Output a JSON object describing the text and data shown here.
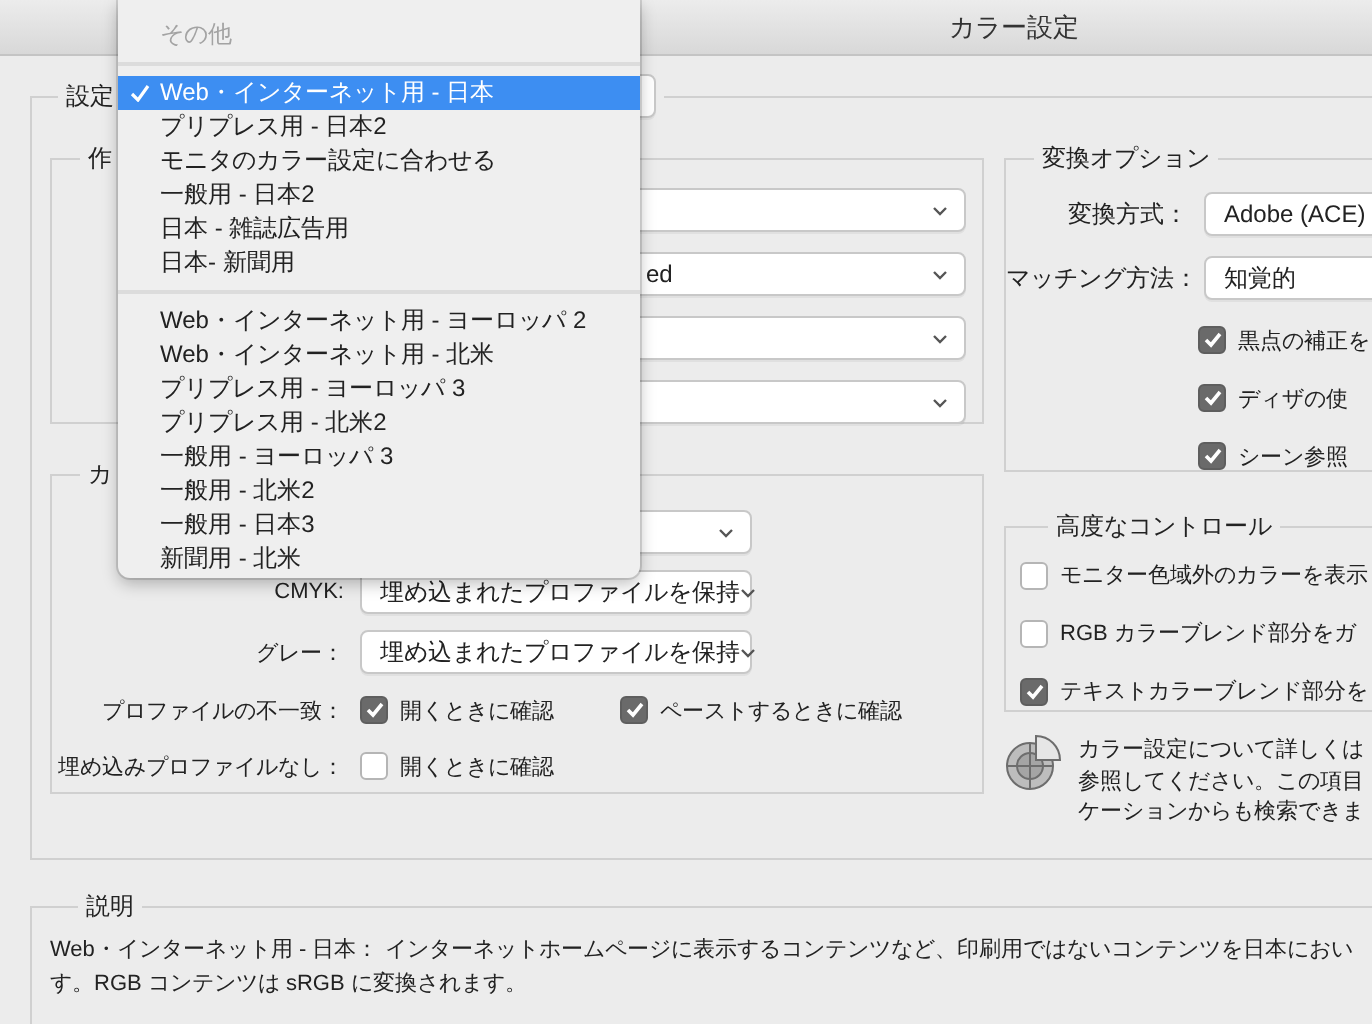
{
  "window": {
    "title": "カラー設定"
  },
  "settings": {
    "label": "設定"
  },
  "working_spaces": {
    "legend": "作",
    "selects": [
      {
        "kind": "dropdown"
      },
      {
        "kind": "dropdown",
        "value": "ed"
      },
      {
        "kind": "dropdown"
      },
      {
        "kind": "dropdown"
      }
    ]
  },
  "color_management": {
    "legend": "カ",
    "rgb": {
      "kind": "dropdown"
    },
    "cmyk": {
      "label": "CMYK:",
      "value": "埋め込まれたプロファイルを保持"
    },
    "gray": {
      "label": "グレー：",
      "value": "埋め込まれたプロファイルを保持"
    },
    "profile_mismatch": {
      "label": "プロファイルの不一致：",
      "checkboxes": [
        {
          "label": "開くときに確認",
          "checked": true
        },
        {
          "label": "ペーストするときに確認",
          "checked": true
        }
      ]
    },
    "missing_profile": {
      "label": "埋め込みプロファイルなし：",
      "checkboxes": [
        {
          "label": "開くときに確認",
          "checked": false
        }
      ]
    }
  },
  "conversion_options": {
    "legend": "変換オプション",
    "engine": {
      "label": "変換方式：",
      "value": "Adobe (ACE)"
    },
    "intent": {
      "label": "マッチング方法：",
      "value": "知覚的"
    },
    "checkboxes": [
      {
        "label": "黒点の補正を",
        "checked": true
      },
      {
        "label": "ディザの使",
        "checked": true
      },
      {
        "label": "シーン参照",
        "checked": true
      }
    ]
  },
  "advanced_controls": {
    "legend": "高度なコントロール",
    "checkboxes": [
      {
        "label": "モニター色域外のカラーを表示",
        "checked": false
      },
      {
        "label": "RGB カラーブレンド部分をガ",
        "checked": false
      },
      {
        "label": "テキストカラーブレンド部分を",
        "checked": true
      }
    ]
  },
  "info": {
    "lines": [
      "カラー設定について詳しくは",
      "参照してください。この項目",
      "ケーションからも検索できま"
    ]
  },
  "description": {
    "legend": "説明",
    "lines": [
      "Web・インターネット用 - 日本： インターネットホームページに表示するコンテンツなど、印刷用ではないコンテンツを日本におい",
      "す。RGB コンテンツは sRGB に変換されます。"
    ]
  },
  "menu": {
    "header": "その他",
    "groups": [
      [
        {
          "label": "Web・インターネット用 - 日本",
          "selected": true
        },
        {
          "label": "プリプレス用 - 日本2",
          "selected": false
        },
        {
          "label": "モニタのカラー設定に合わせる",
          "selected": false
        },
        {
          "label": "一般用 - 日本2",
          "selected": false
        },
        {
          "label": "日本 - 雑誌広告用",
          "selected": false
        },
        {
          "label": "日本- 新聞用",
          "selected": false
        }
      ],
      [
        {
          "label": "Web・インターネット用 - ヨーロッパ 2",
          "selected": false
        },
        {
          "label": "Web・インターネット用 - 北米",
          "selected": false
        },
        {
          "label": "プリプレス用 - ヨーロッパ 3",
          "selected": false
        },
        {
          "label": "プリプレス用 - 北米2",
          "selected": false
        },
        {
          "label": "一般用 - ヨーロッパ 3",
          "selected": false
        },
        {
          "label": "一般用 - 北米2",
          "selected": false
        },
        {
          "label": "一般用 - 日本3",
          "selected": false
        },
        {
          "label": "新聞用 - 北米",
          "selected": false
        }
      ]
    ]
  }
}
